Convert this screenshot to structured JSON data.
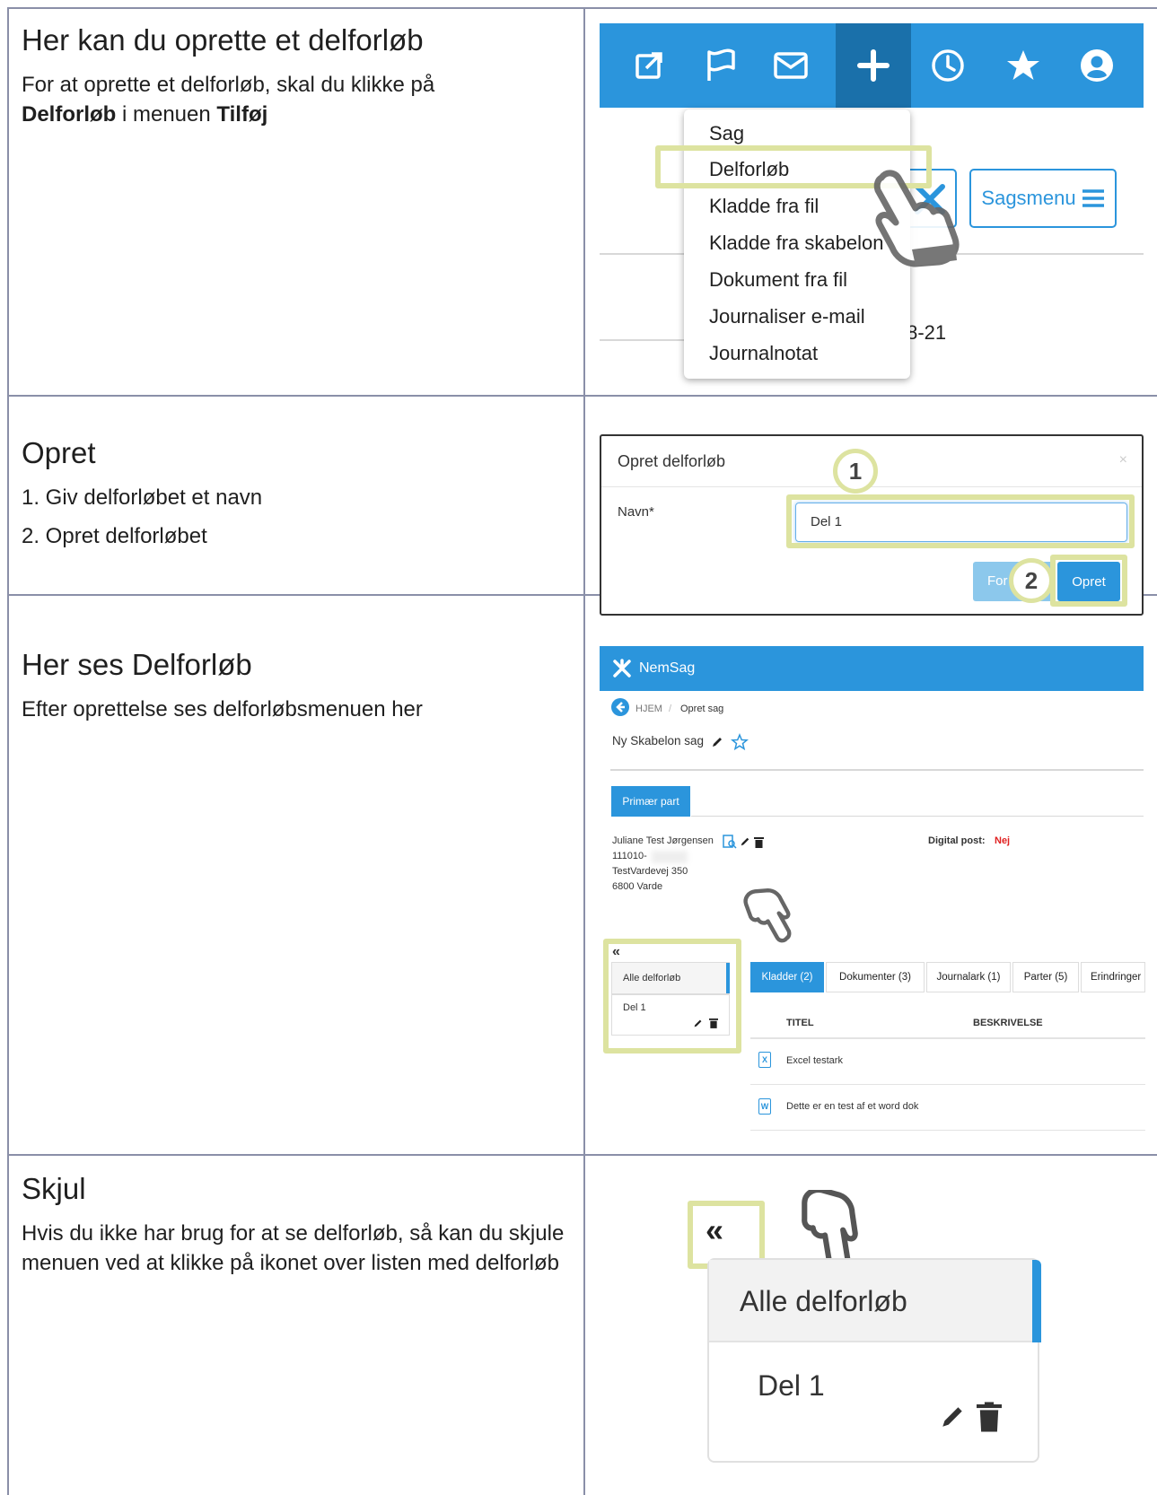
{
  "sections": [
    {
      "heading": "Her kan du oprette et delforløb",
      "text_1": "For at oprette et delforløb, skal du klikke på",
      "bold_1": "Delforløb",
      "text_2": " i menuen ",
      "bold_2": "Tilføj"
    },
    {
      "heading": "Opret",
      "step_1": "1. Giv delforløbet et navn",
      "step_2": "2. Opret delforløbet"
    },
    {
      "heading": "Her ses Delforløb",
      "text": "Efter oprettelse ses delforløbsmenuen her"
    },
    {
      "heading": "Skjul",
      "text": "Hvis du ikke har brug for at se delforløb, så kan du skjule menuen ved at klikke på ikonet over listen med delforløb"
    }
  ],
  "add_menu": {
    "items": [
      "Sag",
      "Delforløb",
      "Kladde fra fil",
      "Kladde fra skabelon",
      "Dokument fra fil",
      "Journaliser e-mail",
      "Journalnotat"
    ],
    "sagsmenu_label": "Sagsmenu",
    "partial_date": ".8-21"
  },
  "dialog": {
    "title": "Opret delforløb",
    "close": "×",
    "name_label": "Navn*",
    "name_value": "Del 1",
    "cancel_partial": "For",
    "submit": "Opret",
    "marker_1": "1",
    "marker_2": "2"
  },
  "nemsag": {
    "app_name": "NemSag",
    "breadcrumb_home": "HJEM",
    "breadcrumb_sep": "/",
    "breadcrumb_current": "Opret sag",
    "case_title": "Ny Skabelon sag",
    "primary_tab": "Primær part",
    "party_name": "Juliane Test Jørgensen",
    "party_cpr": "111010-",
    "party_address": "TestVardevej 350",
    "party_city": "6800 Varde",
    "digital_post_label": "Digital post:",
    "digital_post_value": "Nej",
    "collapse_glyph": "«",
    "all_subprocesses": "Alle delforløb",
    "subprocess": "Del 1",
    "tabs": [
      "Kladder (2)",
      "Dokumenter (3)",
      "Journalark (1)",
      "Parter (5)",
      "Erindringer"
    ],
    "col_title": "TITEL",
    "col_desc": "BESKRIVELSE",
    "files": [
      {
        "icon": "X",
        "name": "Excel testark"
      },
      {
        "icon": "W",
        "name": "Dette er en test af et word dok"
      }
    ]
  },
  "zoom": {
    "collapse_glyph": "«",
    "all_subprocesses": "Alle delforløb",
    "subprocess": "Del 1"
  },
  "colors": {
    "brand_blue": "#2b95dc",
    "highlight": "#dde3a0",
    "digital_post_no": "#e02020"
  }
}
